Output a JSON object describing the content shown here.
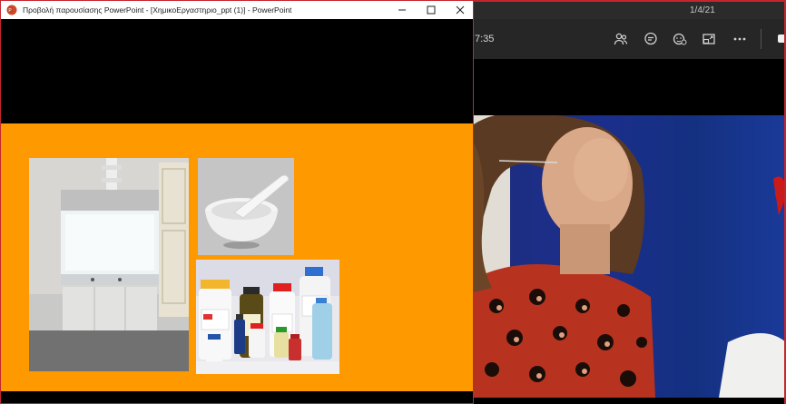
{
  "ppt_window": {
    "title": "Προβολή παρουσίασης PowerPoint - [ΧημικοΕργαστηριο_ppt (1)] - PowerPoint",
    "controls": [
      "minimize",
      "maximize",
      "close"
    ]
  },
  "slide": {
    "background_color": "#ff9900",
    "images": [
      "fume-hood-photo",
      "mortar-and-pestle-photo",
      "chemical-bottles-photo"
    ]
  },
  "teams_window": {
    "date": "1/4/21",
    "timer": "7:35",
    "toolbar_icons": [
      "participants-icon",
      "chat-icon",
      "reactions-icon",
      "share-icon",
      "more-options-icon"
    ],
    "video_feed": "participant-video"
  },
  "colors": {
    "accent_red": "#c4262e",
    "slide_orange": "#ff9900",
    "teams_bar": "#262626"
  }
}
